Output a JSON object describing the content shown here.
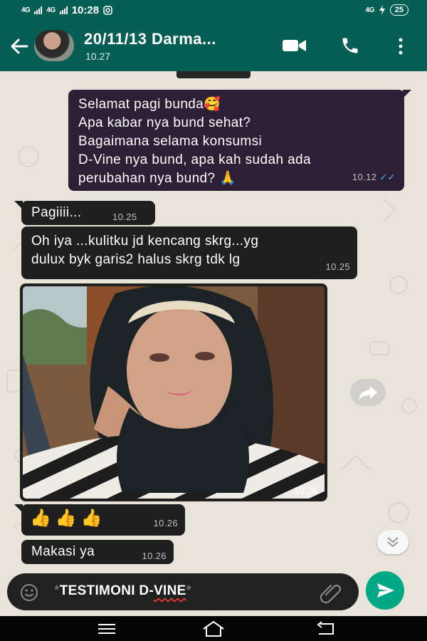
{
  "status_bar": {
    "signal_1": "4G",
    "signal_2": "4G",
    "time": "10:28",
    "net_right": "4G",
    "battery": "25"
  },
  "header": {
    "contact_name": "20/11/13 Darma...",
    "subtitle": "10.27",
    "accent_color": "#075e54",
    "icons": [
      "back-arrow-icon",
      "video-call-icon",
      "phone-icon",
      "more-vertical-icon"
    ]
  },
  "messages": [
    {
      "direction": "outgoing",
      "lines": [
        "Selamat pagi bunda🥰",
        "Apa kabar nya bund sehat?",
        "Bagaimana selama konsumsi",
        "D-Vine nya bund, apa kah sudah ada",
        "perubahan nya bund? 🙏"
      ],
      "time": "10.12",
      "ticks": "✓✓"
    },
    {
      "direction": "incoming",
      "text": "Pagiiii...",
      "time": "10.25"
    },
    {
      "direction": "incoming",
      "lines": [
        "Oh iya ...kulitku jd kencang skrg...yg",
        "dulux byk garis2 halus skrg tdk lg"
      ],
      "time": "10.25"
    },
    {
      "direction": "incoming",
      "type": "image",
      "description_icon": "selfie-photo",
      "time": "10.26"
    },
    {
      "direction": "incoming",
      "text": "👍👍👍",
      "time": "10.26"
    },
    {
      "direction": "incoming",
      "text": "Makasi ya",
      "time": "10.26"
    }
  ],
  "composer": {
    "ast_left": "*",
    "text_a": "TESTIMONI D-",
    "text_b": "VINE",
    "ast_right": "*",
    "send_color": "#00a884"
  }
}
